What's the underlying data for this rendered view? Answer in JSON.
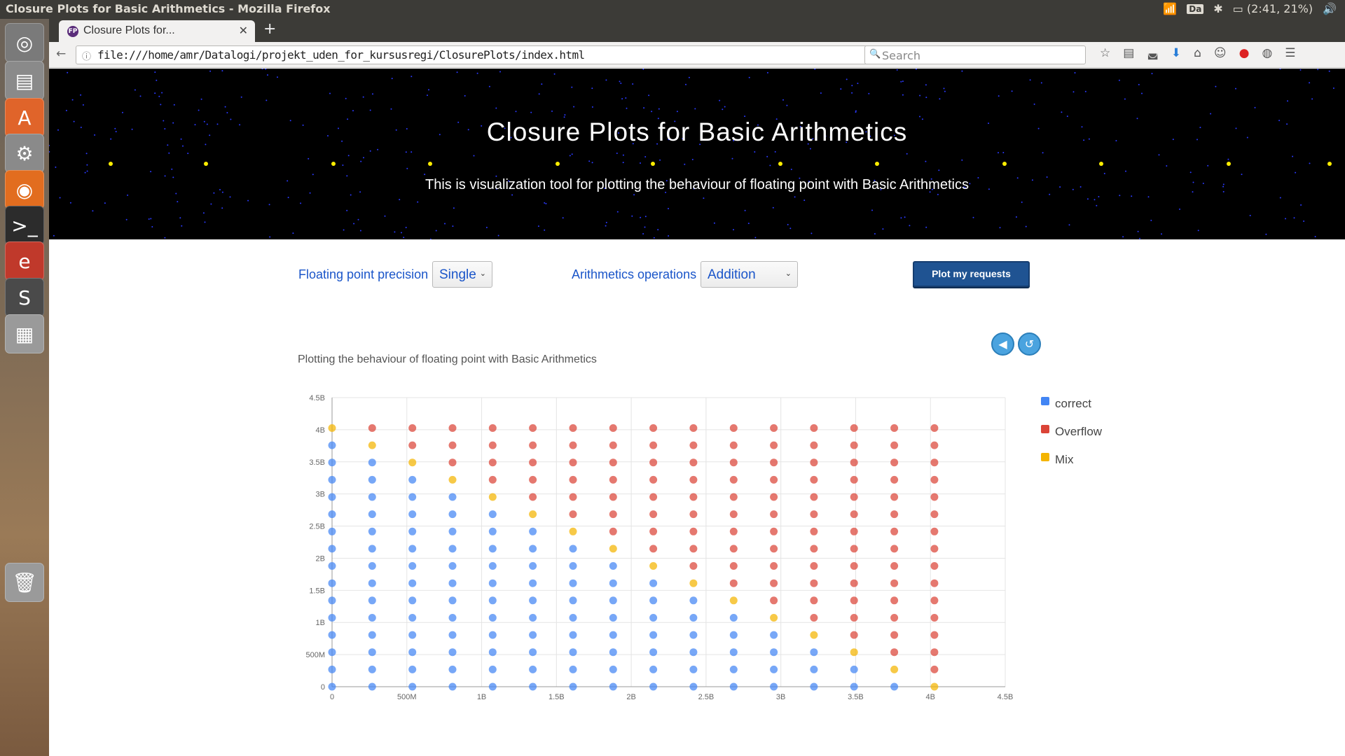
{
  "os": {
    "window_title": "Closure Plots for Basic Arithmetics - Mozilla Firefox",
    "indicators": {
      "keyboard": "Da",
      "battery": "(2:41, 21%)"
    },
    "launcher": [
      {
        "name": "ubuntu-dash-icon",
        "color": "#7a7a7a",
        "glyph": "◎"
      },
      {
        "name": "files-icon",
        "color": "#8a8a8a",
        "glyph": "▤"
      },
      {
        "name": "software-center-icon",
        "color": "#e0642a",
        "glyph": "A"
      },
      {
        "name": "system-settings-icon",
        "color": "#8a8a8a",
        "glyph": "⚙"
      },
      {
        "name": "firefox-icon",
        "color": "#e26d1f",
        "glyph": "◉"
      },
      {
        "name": "terminal-icon",
        "color": "#2c2c2c",
        "glyph": ">_"
      },
      {
        "name": "emacs-icon",
        "color": "#c0392b",
        "glyph": "e"
      },
      {
        "name": "sublime-text-icon",
        "color": "#4a4a4a",
        "glyph": "S"
      },
      {
        "name": "workspace-switcher-icon",
        "color": "#9a9a9a",
        "glyph": "▦"
      },
      {
        "name": "trash-icon",
        "color": "#9a9a9a",
        "glyph": "🗑"
      }
    ]
  },
  "browser": {
    "tab_title": "Closure Plots for...",
    "favicon_text": "FP",
    "url": "file:///home/amr/Datalogi/projekt_uden_for_kursusregi/ClosurePlots/index.html",
    "search_placeholder": "Search"
  },
  "page": {
    "title": "Closure Plots for Basic Arithmetics",
    "subtitle": "This is visualization tool for plotting the behaviour of floating point with Basic Arithmetics",
    "precision_label": "Floating point precision",
    "precision_value": "Single",
    "operation_label": "Arithmetics operations",
    "operation_value": "Addition",
    "plot_button": "Plot my requests",
    "chart_title": "Plotting the behaviour of floating point with Basic Arithmetics"
  },
  "chart_data": {
    "type": "scatter",
    "title": "Plotting the behaviour of floating point with Basic Arithmetics",
    "xlabel": "",
    "ylabel": "",
    "xlim": [
      0,
      4500000000
    ],
    "ylim": [
      0,
      4500000000
    ],
    "x_ticks": [
      "0",
      "500M",
      "1B",
      "1.5B",
      "2B",
      "2.5B",
      "3B",
      "3.5B",
      "4B",
      "4.5B"
    ],
    "y_ticks": [
      "0",
      "500M",
      "1B",
      "1.5B",
      "2B",
      "2.5B",
      "3B",
      "3.5B",
      "4B",
      "4.5B"
    ],
    "grid": true,
    "legend_position": "right",
    "x_values": [
      0,
      268435456,
      536870912,
      805306368,
      1073741824,
      1342177280,
      1610612736,
      1879048192,
      2147483648,
      2415919104,
      2684354560,
      2952790016,
      3221225472,
      3489660928,
      3758096384,
      4026531840
    ],
    "y_values": [
      0,
      268435456,
      536870912,
      805306368,
      1073741824,
      1342177280,
      1610612736,
      1879048192,
      2147483648,
      2415919104,
      2684354560,
      2952790016,
      3221225472,
      3489660928,
      3758096384,
      4026531840
    ],
    "series": [
      {
        "name": "correct",
        "color": "#4285f4",
        "rule": "x + y below 4026531840"
      },
      {
        "name": "Overflow",
        "color": "#db4437",
        "rule": "x + y above 4026531840"
      },
      {
        "name": "Mix",
        "color": "#f4b400",
        "rule": "x + y equal to 4026531840"
      }
    ]
  }
}
